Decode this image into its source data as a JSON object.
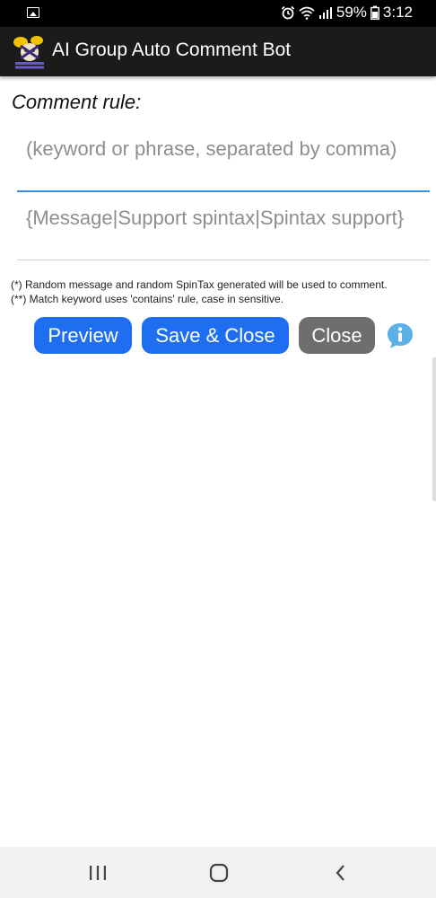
{
  "status_bar": {
    "battery_percent": "59%",
    "time": "3:12",
    "icons": [
      "image-icon",
      "alarm-icon",
      "wifi-icon",
      "signal-icon",
      "battery-icon"
    ]
  },
  "app_bar": {
    "title": "AI Group Auto Comment Bot",
    "logo_icon": "app-logo-icon"
  },
  "form": {
    "section_label": "Comment rule:",
    "keyword_placeholder": "(keyword or phrase, separated by comma)",
    "keyword_value": "",
    "message_placeholder": "{Message|Support spintax|Spintax support}",
    "message_value": "",
    "note_1": "(*) Random message and random SpinTax generated will be used to comment.",
    "note_2": "(**) Match keyword uses 'contains' rule, case in sensitive."
  },
  "actions": {
    "preview_label": "Preview",
    "save_close_label": "Save & Close",
    "close_label": "Close",
    "info_icon": "info-icon"
  },
  "nav_bar": {
    "icons": [
      "recents-icon",
      "home-icon",
      "back-icon"
    ]
  },
  "colors": {
    "primary_button": "#1f6ef2",
    "secondary_button": "#6e6e6e",
    "app_bar": "#1b1b1b",
    "field_focus_line": "#3b8fd6",
    "info_icon": "#5bb0e6"
  }
}
